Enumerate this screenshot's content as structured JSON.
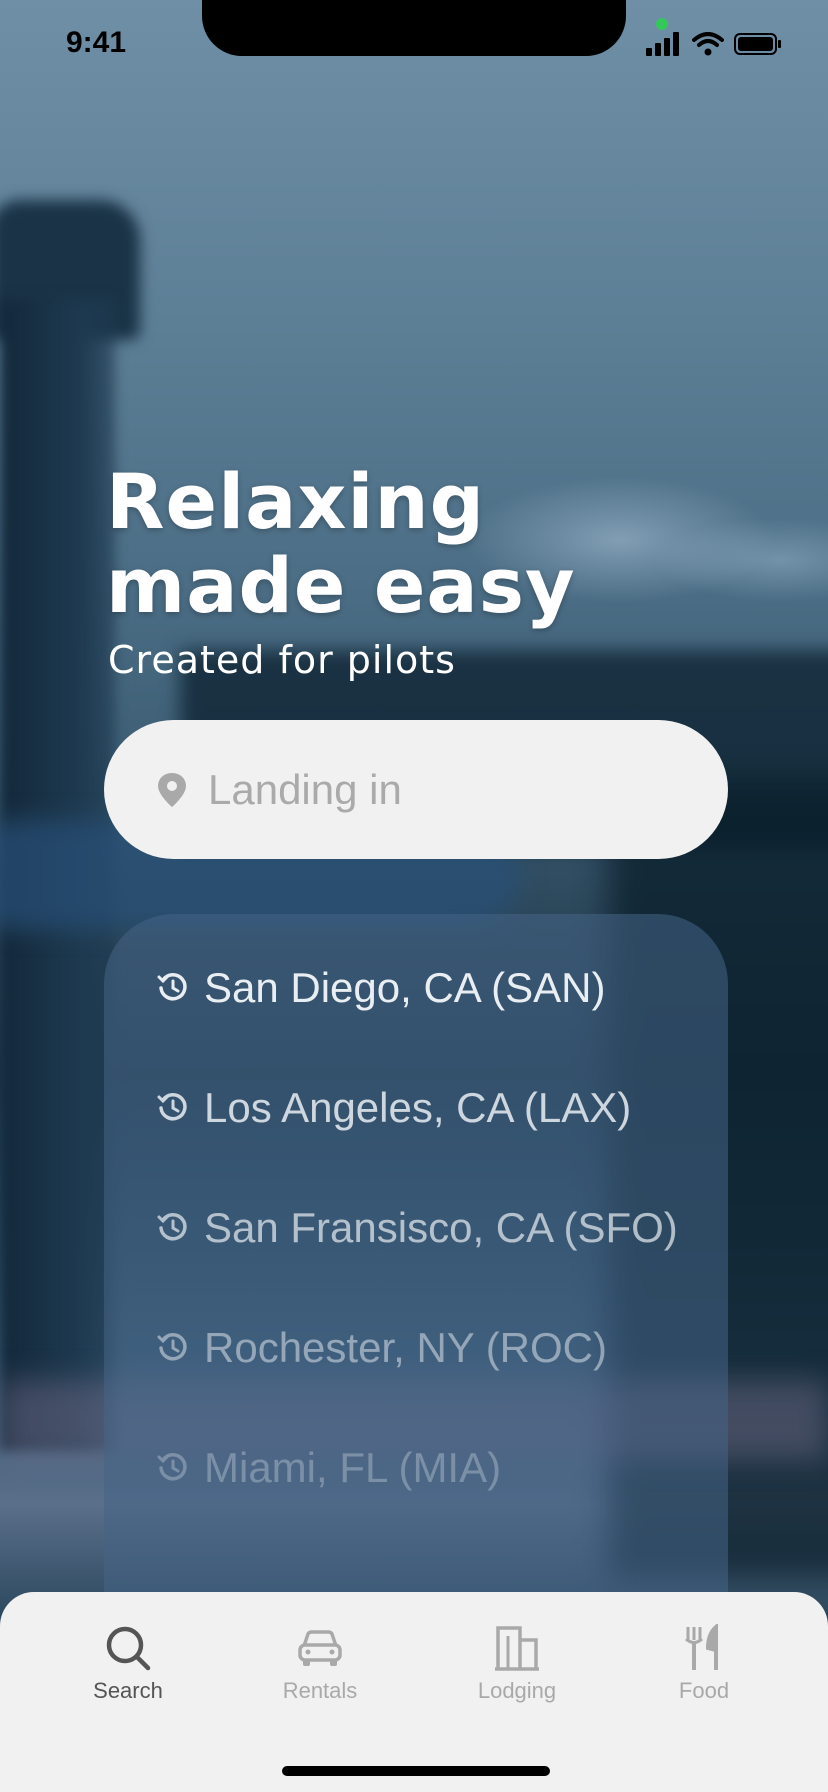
{
  "status_bar": {
    "time": "9:41"
  },
  "hero": {
    "title_line1": "Relaxing",
    "title_line2": "made easy",
    "subtitle": "Created  for pilots"
  },
  "search": {
    "placeholder": "Landing in",
    "icon": "location-pin-icon"
  },
  "recent": {
    "icon": "history-icon",
    "items": [
      {
        "label": "San Diego, CA (SAN)",
        "opacity": 1.0
      },
      {
        "label": "Los Angeles, CA (LAX)",
        "opacity": 0.85
      },
      {
        "label": "San Fransisco, CA (SFO)",
        "opacity": 0.7
      },
      {
        "label": "Rochester, NY (ROC)",
        "opacity": 0.5
      },
      {
        "label": "Miami, FL (MIA)",
        "opacity": 0.3
      }
    ]
  },
  "tabs": [
    {
      "label": "Search",
      "icon": "search-icon",
      "active": true
    },
    {
      "label": "Rentals",
      "icon": "car-icon",
      "active": false
    },
    {
      "label": "Lodging",
      "icon": "building-icon",
      "active": false
    },
    {
      "label": "Food",
      "icon": "fork-knife-icon",
      "active": false
    }
  ],
  "colors": {
    "accent_dark": "#555555",
    "inactive": "#a9a9a9",
    "panel": "#f1f1f1"
  }
}
